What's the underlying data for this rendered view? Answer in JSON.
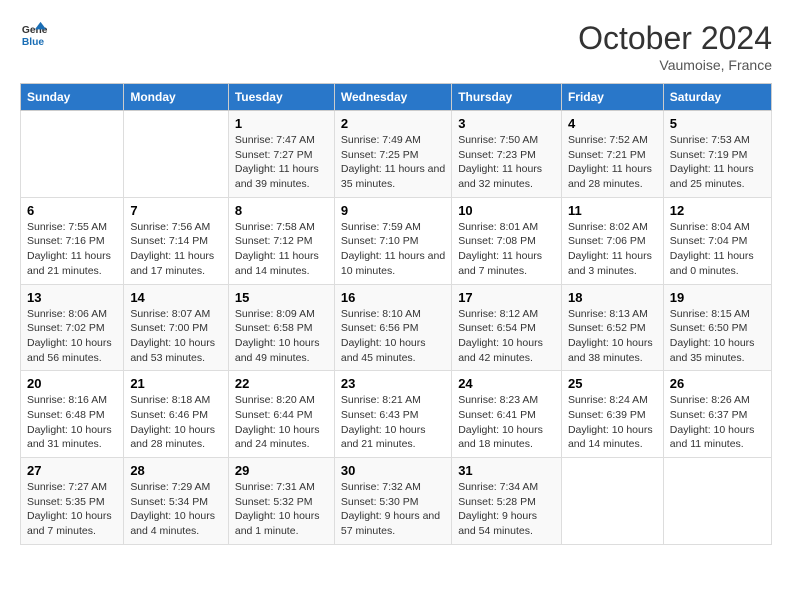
{
  "header": {
    "logo_line1": "General",
    "logo_line2": "Blue",
    "month": "October 2024",
    "location": "Vaumoise, France"
  },
  "weekdays": [
    "Sunday",
    "Monday",
    "Tuesday",
    "Wednesday",
    "Thursday",
    "Friday",
    "Saturday"
  ],
  "weeks": [
    [
      {
        "day": "",
        "info": ""
      },
      {
        "day": "",
        "info": ""
      },
      {
        "day": "1",
        "info": "Sunrise: 7:47 AM\nSunset: 7:27 PM\nDaylight: 11 hours and 39 minutes."
      },
      {
        "day": "2",
        "info": "Sunrise: 7:49 AM\nSunset: 7:25 PM\nDaylight: 11 hours and 35 minutes."
      },
      {
        "day": "3",
        "info": "Sunrise: 7:50 AM\nSunset: 7:23 PM\nDaylight: 11 hours and 32 minutes."
      },
      {
        "day": "4",
        "info": "Sunrise: 7:52 AM\nSunset: 7:21 PM\nDaylight: 11 hours and 28 minutes."
      },
      {
        "day": "5",
        "info": "Sunrise: 7:53 AM\nSunset: 7:19 PM\nDaylight: 11 hours and 25 minutes."
      }
    ],
    [
      {
        "day": "6",
        "info": "Sunrise: 7:55 AM\nSunset: 7:16 PM\nDaylight: 11 hours and 21 minutes."
      },
      {
        "day": "7",
        "info": "Sunrise: 7:56 AM\nSunset: 7:14 PM\nDaylight: 11 hours and 17 minutes."
      },
      {
        "day": "8",
        "info": "Sunrise: 7:58 AM\nSunset: 7:12 PM\nDaylight: 11 hours and 14 minutes."
      },
      {
        "day": "9",
        "info": "Sunrise: 7:59 AM\nSunset: 7:10 PM\nDaylight: 11 hours and 10 minutes."
      },
      {
        "day": "10",
        "info": "Sunrise: 8:01 AM\nSunset: 7:08 PM\nDaylight: 11 hours and 7 minutes."
      },
      {
        "day": "11",
        "info": "Sunrise: 8:02 AM\nSunset: 7:06 PM\nDaylight: 11 hours and 3 minutes."
      },
      {
        "day": "12",
        "info": "Sunrise: 8:04 AM\nSunset: 7:04 PM\nDaylight: 11 hours and 0 minutes."
      }
    ],
    [
      {
        "day": "13",
        "info": "Sunrise: 8:06 AM\nSunset: 7:02 PM\nDaylight: 10 hours and 56 minutes."
      },
      {
        "day": "14",
        "info": "Sunrise: 8:07 AM\nSunset: 7:00 PM\nDaylight: 10 hours and 53 minutes."
      },
      {
        "day": "15",
        "info": "Sunrise: 8:09 AM\nSunset: 6:58 PM\nDaylight: 10 hours and 49 minutes."
      },
      {
        "day": "16",
        "info": "Sunrise: 8:10 AM\nSunset: 6:56 PM\nDaylight: 10 hours and 45 minutes."
      },
      {
        "day": "17",
        "info": "Sunrise: 8:12 AM\nSunset: 6:54 PM\nDaylight: 10 hours and 42 minutes."
      },
      {
        "day": "18",
        "info": "Sunrise: 8:13 AM\nSunset: 6:52 PM\nDaylight: 10 hours and 38 minutes."
      },
      {
        "day": "19",
        "info": "Sunrise: 8:15 AM\nSunset: 6:50 PM\nDaylight: 10 hours and 35 minutes."
      }
    ],
    [
      {
        "day": "20",
        "info": "Sunrise: 8:16 AM\nSunset: 6:48 PM\nDaylight: 10 hours and 31 minutes."
      },
      {
        "day": "21",
        "info": "Sunrise: 8:18 AM\nSunset: 6:46 PM\nDaylight: 10 hours and 28 minutes."
      },
      {
        "day": "22",
        "info": "Sunrise: 8:20 AM\nSunset: 6:44 PM\nDaylight: 10 hours and 24 minutes."
      },
      {
        "day": "23",
        "info": "Sunrise: 8:21 AM\nSunset: 6:43 PM\nDaylight: 10 hours and 21 minutes."
      },
      {
        "day": "24",
        "info": "Sunrise: 8:23 AM\nSunset: 6:41 PM\nDaylight: 10 hours and 18 minutes."
      },
      {
        "day": "25",
        "info": "Sunrise: 8:24 AM\nSunset: 6:39 PM\nDaylight: 10 hours and 14 minutes."
      },
      {
        "day": "26",
        "info": "Sunrise: 8:26 AM\nSunset: 6:37 PM\nDaylight: 10 hours and 11 minutes."
      }
    ],
    [
      {
        "day": "27",
        "info": "Sunrise: 7:27 AM\nSunset: 5:35 PM\nDaylight: 10 hours and 7 minutes."
      },
      {
        "day": "28",
        "info": "Sunrise: 7:29 AM\nSunset: 5:34 PM\nDaylight: 10 hours and 4 minutes."
      },
      {
        "day": "29",
        "info": "Sunrise: 7:31 AM\nSunset: 5:32 PM\nDaylight: 10 hours and 1 minute."
      },
      {
        "day": "30",
        "info": "Sunrise: 7:32 AM\nSunset: 5:30 PM\nDaylight: 9 hours and 57 minutes."
      },
      {
        "day": "31",
        "info": "Sunrise: 7:34 AM\nSunset: 5:28 PM\nDaylight: 9 hours and 54 minutes."
      },
      {
        "day": "",
        "info": ""
      },
      {
        "day": "",
        "info": ""
      }
    ]
  ]
}
